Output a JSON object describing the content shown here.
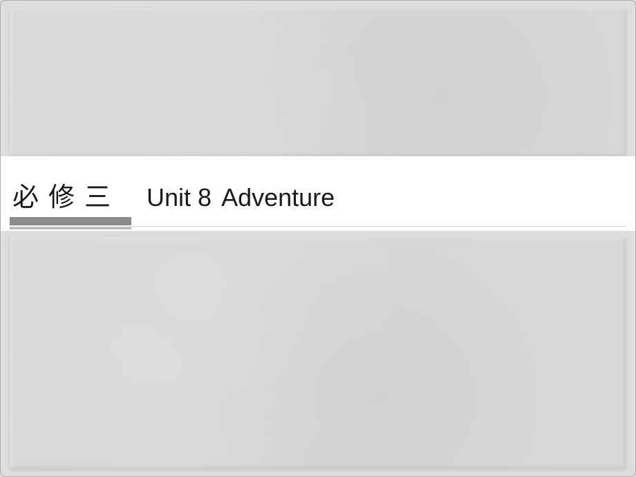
{
  "title": {
    "book_level": "必修三",
    "unit_label": "Unit 8",
    "unit_topic": "Adventure"
  }
}
